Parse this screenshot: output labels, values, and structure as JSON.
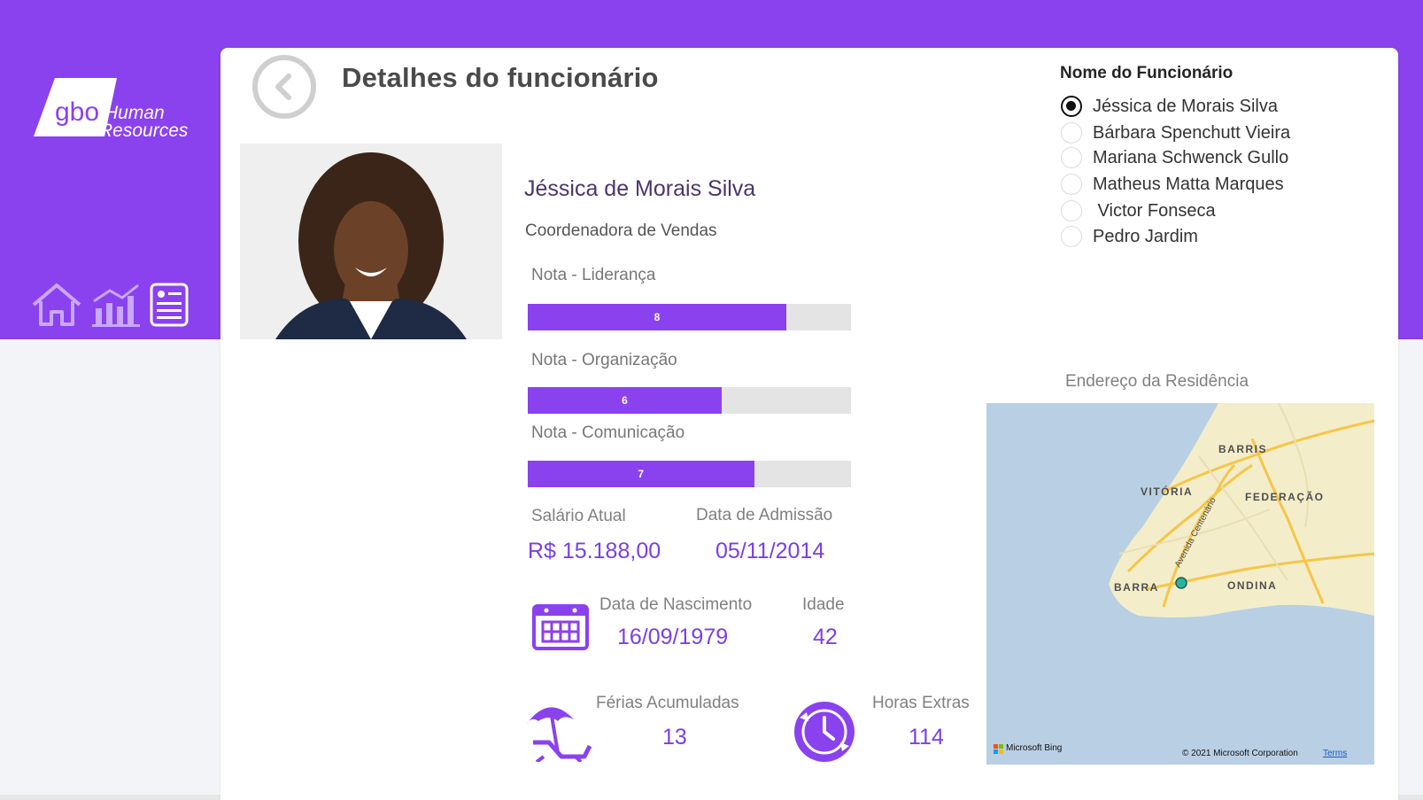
{
  "brand": {
    "logo_line1": "gbo",
    "logo_line2": "Human",
    "logo_line3": "Resources"
  },
  "nav": {
    "items": [
      {
        "icon": "home-icon"
      },
      {
        "icon": "bar-chart-icon"
      },
      {
        "icon": "report-icon"
      }
    ]
  },
  "header": {
    "title": "Detalhes do funcionário",
    "back_icon": "chevron-left-icon"
  },
  "employee": {
    "name": "Jéssica de Morais Silva",
    "role": "Coordenadora de Vendas"
  },
  "scores": [
    {
      "label": "Nota - Liderança",
      "value": 8,
      "max": 10
    },
    {
      "label": "Nota - Organização",
      "value": 6,
      "max": 10
    },
    {
      "label": "Nota - Comunicação",
      "value": 7,
      "max": 10
    }
  ],
  "kpis": {
    "salary": {
      "label": "Salário Atual",
      "value": "R$ 15.188,00"
    },
    "admission": {
      "label": "Data de Admissão",
      "value": "05/11/2014"
    },
    "birth": {
      "label": "Data de Nascimento",
      "value": "16/09/1979",
      "icon": "calendar-icon"
    },
    "age": {
      "label": "Idade",
      "value": "42"
    },
    "vacation": {
      "label": "Férias Acumuladas",
      "value": "13",
      "icon": "beach-umbrella-icon"
    },
    "overtime": {
      "label": "Horas Extras",
      "value": "114",
      "icon": "clock-icon"
    }
  },
  "slicer": {
    "title": "Nome do Funcionário",
    "options": [
      {
        "label": "Jéssica de Morais Silva",
        "selected": true
      },
      {
        "label": "Bárbara Spenchutt Vieira",
        "selected": false
      },
      {
        "label": "Mariana Schwenck Gullo",
        "selected": false
      },
      {
        "label": "Matheus Matta Marques",
        "selected": false
      },
      {
        "label": " Victor Fonseca",
        "selected": false
      },
      {
        "label": "Pedro Jardim",
        "selected": false
      }
    ]
  },
  "map": {
    "title": "Endereço da Residência",
    "labels": {
      "barris": "BARRIS",
      "vitoria": "VITÓRIA",
      "federacao": "FEDERAÇÃO",
      "avenida": "Avenida Centenário",
      "barra": "BARRA",
      "ondina": "ONDINA"
    },
    "provider": "Microsoft Bing",
    "copyright": "© 2021 Microsoft Corporation",
    "terms": "Terms"
  },
  "colors": {
    "accent": "#8a42ee",
    "value_text": "#7b3fe4",
    "bar_track": "#e4e4e4",
    "map_water": "#b9cfe4",
    "map_land": "#f4edc9"
  }
}
